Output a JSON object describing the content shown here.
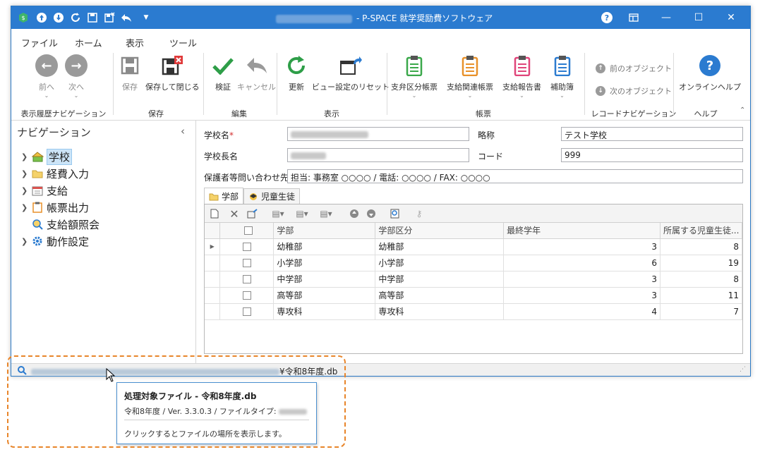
{
  "titlebar": {
    "app_title": "- P-SPACE 就学奨励費ソフトウェア",
    "help_icon": "?",
    "minimize": "—",
    "maximize": "☐",
    "close": "✕"
  },
  "menu": {
    "items": [
      "ファイル",
      "ホーム",
      "表示",
      "ツール"
    ],
    "active": "ホーム"
  },
  "ribbon": {
    "groups": [
      {
        "label": "表示履歴ナビゲーション",
        "buttons": [
          "前へ",
          "次へ"
        ]
      },
      {
        "label": "保存",
        "buttons": [
          "保存",
          "保存して閉じる"
        ]
      },
      {
        "label": "編集",
        "buttons": [
          "検証",
          "キャンセル"
        ]
      },
      {
        "label": "表示",
        "buttons": [
          "更新",
          "ビュー設定のリセット"
        ]
      },
      {
        "label": "帳票",
        "buttons": [
          "支弁区分帳票",
          "支給関連帳票",
          "支給報告書",
          "補助簿"
        ]
      },
      {
        "label": "レコードナビゲーション",
        "buttons": [
          "前のオブジェクト",
          "次のオブジェクト"
        ]
      },
      {
        "label": "ヘルプ",
        "buttons": [
          "オンラインヘルプ"
        ]
      }
    ]
  },
  "navigation": {
    "title": "ナビゲーション",
    "collapse": "‹",
    "items": [
      {
        "label": "学校",
        "selected": true,
        "expandable": true
      },
      {
        "label": "経費入力",
        "expandable": true
      },
      {
        "label": "支給",
        "expandable": true
      },
      {
        "label": "帳票出力",
        "expandable": true
      },
      {
        "label": "支給額照会",
        "expandable": false
      },
      {
        "label": "動作設定",
        "expandable": true
      }
    ]
  },
  "form": {
    "school_name_label": "学校名",
    "required_mark": "*",
    "abbr_label": "略称",
    "abbr_value": "テスト学校",
    "principal_label": "学校長名",
    "code_label": "コード",
    "code_value": "999",
    "contact_label": "保護者等問い合わせ先",
    "contact_value": "担当: 事務室 ○○○○ / 電話: ○○○○ / FAX: ○○○○"
  },
  "tabs": [
    "学部",
    "児童生徒"
  ],
  "grid": {
    "columns": [
      "学部",
      "学部区分",
      "最終学年",
      "所属する児童生徒..."
    ],
    "rows": [
      {
        "gakubu": "幼稚部",
        "kubun": "幼稚部",
        "final": "3",
        "count": "8"
      },
      {
        "gakubu": "小学部",
        "kubun": "小学部",
        "final": "6",
        "count": "19"
      },
      {
        "gakubu": "中学部",
        "kubun": "中学部",
        "final": "3",
        "count": "8"
      },
      {
        "gakubu": "高等部",
        "kubun": "高等部",
        "final": "3",
        "count": "11"
      },
      {
        "gakubu": "専攻科",
        "kubun": "専攻科",
        "final": "4",
        "count": "7"
      }
    ]
  },
  "statusbar": {
    "path_suffix": "¥令和8年度.db"
  },
  "tooltip": {
    "title": "処理対象ファイル - 令和8年度.db",
    "info": "令和8年度 / Ver. 3.3.0.3 / ファイルタイプ:",
    "hint": "クリックするとファイルの場所を表示します。"
  }
}
